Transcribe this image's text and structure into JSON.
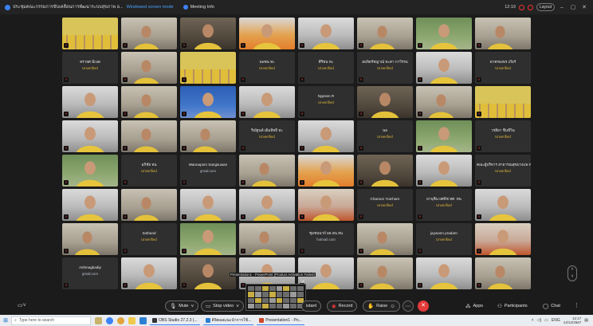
{
  "titlebar": {
    "title": "ประชุมคณะกรรมการขับเคลื่อนการพัฒนาระบบสุขภาพ อ...",
    "subtitle": "Windowed screen mode",
    "meeting_info": "Meeting Info",
    "time": "12:19",
    "layout_label": "Layout"
  },
  "tiles": [
    {
      "kind": "video",
      "variant": "group"
    },
    {
      "kind": "video",
      "variant": "alt"
    },
    {
      "kind": "video",
      "variant": "dark"
    },
    {
      "kind": "video",
      "variant": "orange"
    },
    {
      "kind": "video",
      "variant": ""
    },
    {
      "kind": "video",
      "variant": "alt"
    },
    {
      "kind": "video",
      "variant": "green"
    },
    {
      "kind": "video",
      "variant": "alt"
    },
    {
      "kind": "name",
      "name": "ทรายศ มีเนต",
      "sub": "Unverified"
    },
    {
      "kind": "video",
      "variant": "alt"
    },
    {
      "kind": "video",
      "variant": "group"
    },
    {
      "kind": "name",
      "name": "นพชน ทะ",
      "sub": "Unverified"
    },
    {
      "kind": "name",
      "name": "ศิริชน ทะ",
      "sub": "Unverified"
    },
    {
      "kind": "name",
      "name": "สมจิตรัชญาณ์ ทะคา กาวีรรม",
      "sub": "Unverified"
    },
    {
      "kind": "video",
      "variant": ""
    },
    {
      "kind": "name",
      "name": "ตาครองพร เกียร์",
      "sub": "Unverified"
    },
    {
      "kind": "video",
      "variant": ""
    },
    {
      "kind": "video",
      "variant": "alt"
    },
    {
      "kind": "video",
      "variant": "blue"
    },
    {
      "kind": "video",
      "variant": ""
    },
    {
      "kind": "name",
      "name": "Ngesen R",
      "sub": "Unverified"
    },
    {
      "kind": "video",
      "variant": "dark"
    },
    {
      "kind": "video",
      "variant": "alt"
    },
    {
      "kind": "video",
      "variant": "group"
    },
    {
      "kind": "video",
      "variant": ""
    },
    {
      "kind": "video",
      "variant": "alt"
    },
    {
      "kind": "video",
      "variant": "alt"
    },
    {
      "kind": "name",
      "name": "ริณัฐนต์ เต็มสิทธิ์ ทะ",
      "sub": "Unverified"
    },
    {
      "kind": "video",
      "variant": ""
    },
    {
      "kind": "name",
      "name": "นล",
      "sub": "Unverified"
    },
    {
      "kind": "video",
      "variant": "green"
    },
    {
      "kind": "name",
      "name": "วรสิยา ชื่นชีวิน",
      "sub": "Unverified"
    },
    {
      "kind": "video",
      "variant": "green"
    },
    {
      "kind": "name",
      "name": "อภิชัย ทน",
      "sub": "Unverified"
    },
    {
      "kind": "name",
      "name": "Wannapom Sangsuwan",
      "sub": "gmail.com",
      "ok": true
    },
    {
      "kind": "video",
      "variant": "alt"
    },
    {
      "kind": "video",
      "variant": "orange"
    },
    {
      "kind": "video",
      "variant": "dark"
    },
    {
      "kind": "video",
      "variant": ""
    },
    {
      "kind": "name",
      "name": "คณะผู้บริหาร สาธารณสุขบางแพ ทน",
      "sub": "Unverified"
    },
    {
      "kind": "video",
      "variant": ""
    },
    {
      "kind": "video",
      "variant": "alt"
    },
    {
      "kind": "video",
      "variant": ""
    },
    {
      "kind": "video",
      "variant": ""
    },
    {
      "kind": "video",
      "variant": "red"
    },
    {
      "kind": "name",
      "name": "Charoon Yutcharn",
      "sub": "Unverified"
    },
    {
      "kind": "name",
      "name": "ยานุชิน ยศพิช ทศ. ทน",
      "sub": "Unverified"
    },
    {
      "kind": "video",
      "variant": ""
    },
    {
      "kind": "video",
      "variant": "alt"
    },
    {
      "kind": "name",
      "name": "Sothand",
      "sub": "Unverified"
    },
    {
      "kind": "video",
      "variant": "green"
    },
    {
      "kind": "video",
      "variant": "alt"
    },
    {
      "kind": "name",
      "name": "ชุมชนนาถ์ ผล สน สน",
      "sub": "hotmail.com",
      "ok": true
    },
    {
      "kind": "video",
      "variant": "alt"
    },
    {
      "kind": "name",
      "name": "jaywann pradarn",
      "sub": "Unverified"
    },
    {
      "kind": "video",
      "variant": "red"
    },
    {
      "kind": "name",
      "name": "Ashmagkadip",
      "sub": "gmail.com",
      "ok": true
    },
    {
      "kind": "video",
      "variant": ""
    },
    {
      "kind": "video",
      "variant": "dark"
    },
    {
      "kind": "video",
      "variant": ""
    },
    {
      "kind": "video",
      "variant": ""
    },
    {
      "kind": "video",
      "variant": "alt"
    },
    {
      "kind": "video",
      "variant": ""
    },
    {
      "kind": "video",
      "variant": "alt"
    }
  ],
  "share_popup": {
    "title": "Presentation1 - PowerPoint (Product Activation Failed)"
  },
  "toolbar": {
    "mute": "Mute",
    "stop_video": "Stop video",
    "share_label": "istant",
    "record": "Record",
    "raise": "Raise",
    "apps": "Apps",
    "participants": "Participants",
    "chat": "Chat"
  },
  "taskbar": {
    "search_placeholder": "Type here to search",
    "apps": [
      {
        "label": "OBS Studio 27.2.3 (..."
      },
      {
        "label": "ดิจิตอลแนะนำการใช้..."
      },
      {
        "label": "Presentation1 - Po..."
      }
    ],
    "lang": "ENG",
    "time": "12:17",
    "date": "14/12/2567"
  },
  "colors": {
    "unverified": "#e0b63a",
    "end_button": "#e33a3a",
    "accent": "#3b82f6"
  }
}
